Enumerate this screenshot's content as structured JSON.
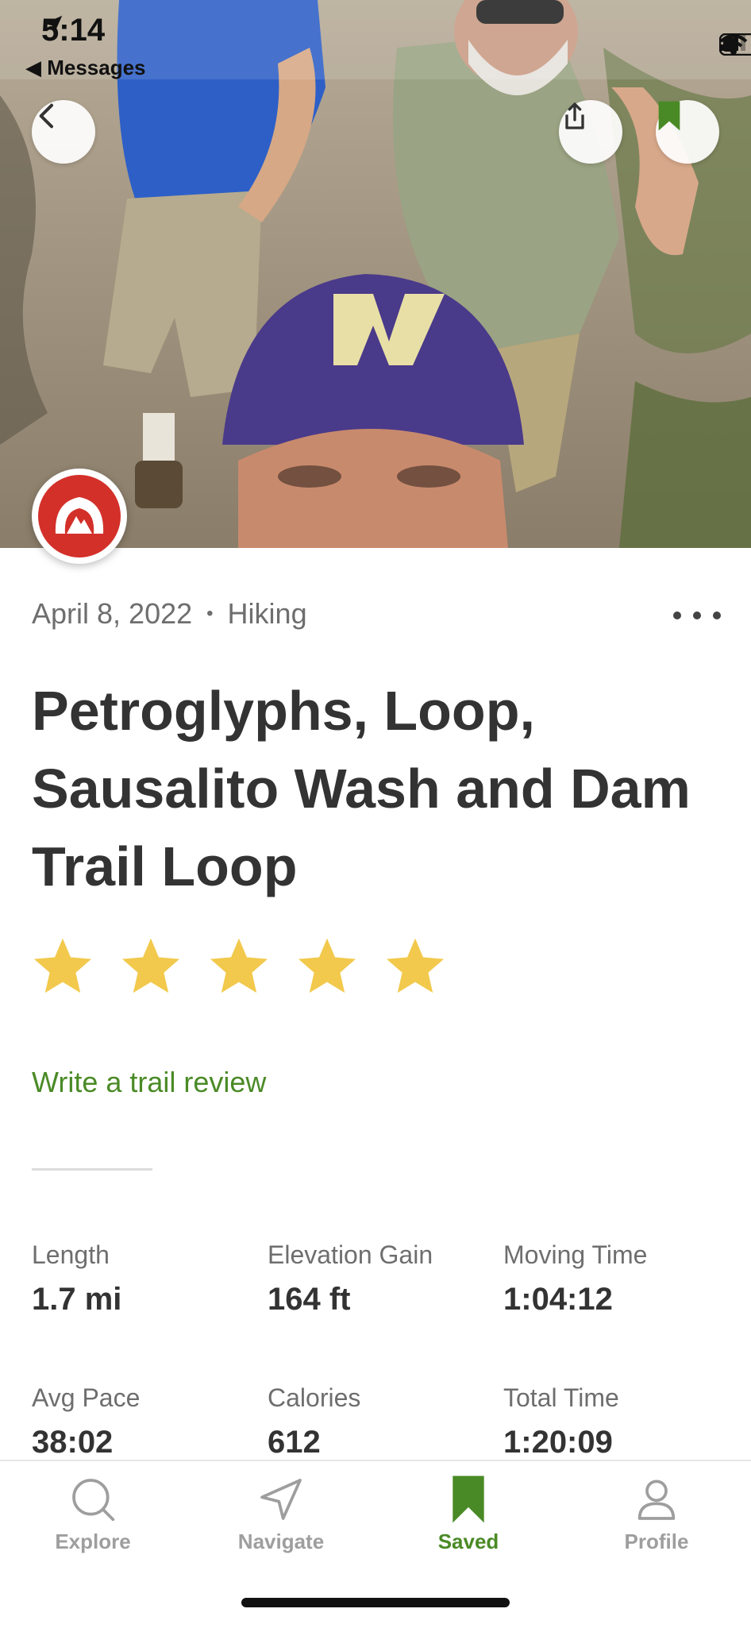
{
  "status_bar": {
    "time": "5:14",
    "back_label": "◀ Messages"
  },
  "activity": {
    "date": "April 8, 2022",
    "separator": "•",
    "type": "Hiking",
    "title": "Petroglyphs, Loop, Sausalito Wash and Dam Trail Loop",
    "rating": 5,
    "rating_max": 5,
    "review_link": "Write a trail review"
  },
  "stats": [
    {
      "label": "Length",
      "value": "1.7 mi"
    },
    {
      "label": "Elevation Gain",
      "value": "164 ft"
    },
    {
      "label": "Moving Time",
      "value": "1:04:12"
    },
    {
      "label": "Avg Pace",
      "value": "38:02"
    },
    {
      "label": "Calories",
      "value": "612"
    },
    {
      "label": "Total Time",
      "value": "1:20:09"
    }
  ],
  "tabs": [
    {
      "label": "Explore",
      "icon": "search-icon"
    },
    {
      "label": "Navigate",
      "icon": "navigate-icon"
    },
    {
      "label": "Saved",
      "icon": "bookmark-icon"
    },
    {
      "label": "Profile",
      "icon": "profile-icon"
    }
  ],
  "colors": {
    "accent": "#4a8a26",
    "star": "#f2c94c",
    "brand_red": "#d3302a"
  }
}
